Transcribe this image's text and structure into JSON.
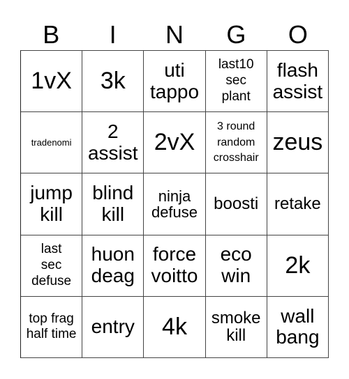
{
  "header": {
    "letters": [
      "B",
      "I",
      "N",
      "G",
      "O"
    ]
  },
  "board": {
    "rows": [
      [
        "1vX",
        "3k",
        "uti tappo",
        "last10 sec plant",
        "flash assist"
      ],
      [
        "tradenomi",
        "2 assist",
        "2vX",
        "3 round random crosshair",
        "zeus"
      ],
      [
        "jump kill",
        "blind kill",
        "ninja defuse",
        "boosti",
        "retake"
      ],
      [
        "last sec defuse",
        "huon deag",
        "force voitto",
        "eco win",
        "2k"
      ],
      [
        "top frag half time",
        "entry",
        "4k",
        "smoke kill",
        "wall bang"
      ]
    ]
  },
  "colors": {
    "grid_line": "#444444",
    "text": "#000000",
    "background": "#ffffff"
  }
}
